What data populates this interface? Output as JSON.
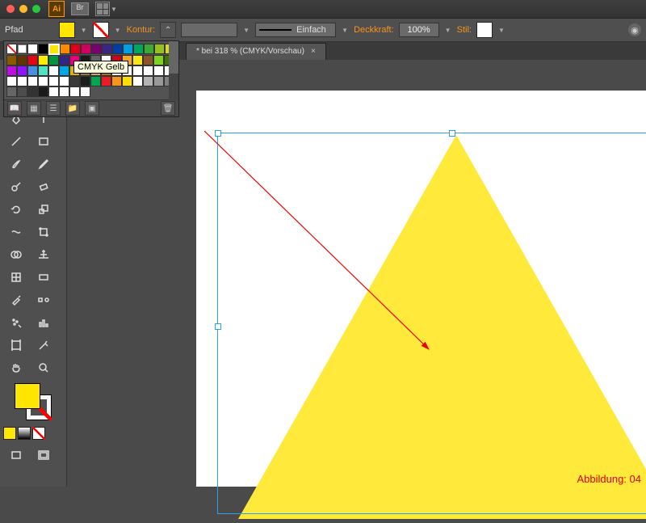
{
  "titlebar": {
    "app": "Ai",
    "br": "Br"
  },
  "control": {
    "selection": "Pfad",
    "kontur_lbl": "Kontur:",
    "stroke_style": "Einfach",
    "opacity_lbl": "Deckkraft:",
    "opacity_val": "100%",
    "stil_lbl": "Stil:"
  },
  "doc_tab": "* bei 318 % (CMYK/Vorschau)",
  "tooltip": "CMYK Gelb",
  "caption": "Abbildung: 04",
  "swatches": {
    "rows": [
      [
        "#fff-none",
        "#fff-reg",
        "#fff",
        "#000",
        "#ffe600-sel",
        "#ff8a00",
        "#e0001a",
        "#d10060",
        "#7a006e",
        "#3a2785",
        "#003da6",
        "#009fe3",
        "#00a65d",
        "#3aaa35",
        "#95c11f",
        "#dedc00",
        "#8a5a00",
        "#613400"
      ],
      [
        "#e30613",
        "#ffed00",
        "#009640",
        "#312783",
        "#e6007e",
        "#1a1a1a",
        "#626262",
        "#fff",
        "#d0021b",
        "#f5a623",
        "#f8e71c",
        "#8b572a",
        "#7ed321",
        "#417505",
        "#bd10e0",
        "#9013fe",
        "#4a90e2",
        "#50e3c2"
      ],
      [
        "#fff",
        "#00a6eb",
        "#e2b400",
        "#9d7a3b",
        "#c9a95e",
        "#a67c00",
        "#fff",
        "#fff",
        "#fff",
        "#fff",
        "#fff",
        "#fff",
        "#fff",
        "#fff",
        "#fff",
        "#fff",
        "#fff",
        "#fff"
      ],
      [
        "#3a3a3a",
        "#1d1d1d",
        "#00a651",
        "#ed1c24",
        "#f7941d",
        "#ffde00",
        "#fff",
        "#b3b3b3",
        "#999",
        "#808080",
        "#666",
        "#4d4d4d",
        "#333",
        "#1a1a1a",
        "#fff",
        "#fff",
        "#fff",
        "#fff"
      ]
    ]
  },
  "chart_data": null
}
